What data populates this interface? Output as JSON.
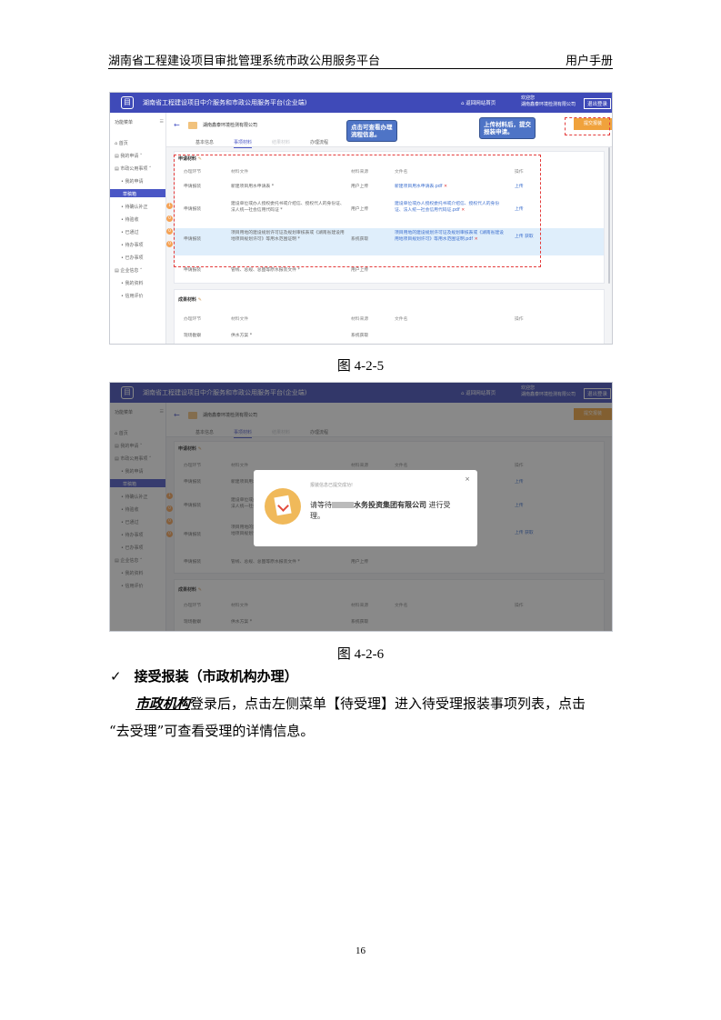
{
  "header": {
    "left": "湖南省工程建设项目审批管理系统市政公用服务平台",
    "right": "用户手册"
  },
  "app": {
    "title": "湖南省工程建设项目中介服务和市政公用服务平台(企业端)",
    "home_link": "⌂ 返回网站首页",
    "welcome_line1": "欢迎您",
    "welcome_line2": "湖南鑫泰环境检测有限公司",
    "logout": "退出登录",
    "company": "湖南鑫泰环境检测有限公司",
    "submit_button": "提交报装"
  },
  "sidebar": {
    "title": "功能菜单",
    "items": [
      "首页",
      "我的申请",
      "市政公用事项",
      "我的申请",
      "草稿箱",
      "待确认补正",
      "待验收",
      "已通过",
      "待办事项",
      "已办事项",
      "企业信息",
      "我的资料",
      "信用评价"
    ],
    "badges": [
      "1",
      "1",
      "0",
      "0",
      "0"
    ]
  },
  "tabs": [
    "基本信息",
    "事项材料",
    "结果材料",
    "办理流程"
  ],
  "apply_section": {
    "title": "申请材料",
    "headers": [
      "办理环节",
      "材料文件",
      "材料来源",
      "文件名",
      "操作"
    ],
    "rows": [
      {
        "stage": "申请报装",
        "material": "新建项目用水申请表 *",
        "source": "用户上传",
        "file": "新建项目用水申请表.pdf",
        "op": "上传"
      },
      {
        "stage": "申请报装",
        "material": "建设单位或办人授权委托书或介绍信、授权代人的身份证、法人统一社会信用代码证 *",
        "source": "用户上传",
        "file": "建设单位或办人授权委托书或介绍信、授权代人的身份证、法人统一社会信用代码证.pdf",
        "op": "上传"
      },
      {
        "stage": "申请报装",
        "material": "项目用地的建设规划许可证及规划审核表或《湖南省建设用地项目规划许可》等用水范围证明 *",
        "source": "系统获取",
        "file": "项目用地的建设规划许可证及规划审核表或《湖南省建设用地项目规划许可》等用水范围证明.pdf",
        "op": "上传 获取"
      },
      {
        "stage": "申请报装",
        "material": "管线、总规、总图等原水报装文件 *",
        "source": "用户上传",
        "file": "",
        "op": ""
      }
    ]
  },
  "result_section": {
    "title": "成果材料",
    "headers": [
      "办理环节",
      "材料文件",
      "材料来源",
      "文件名",
      "操作"
    ],
    "rows": [
      {
        "stage": "现场勘察",
        "material": "供水方案 *",
        "source": "系统获取"
      }
    ]
  },
  "callouts": {
    "flow": "点击可查看办理\n流程信息。",
    "upload": "上传材料后，提交\n报装申请。"
  },
  "modal": {
    "title": "报装信息已提交成功!",
    "msg_prefix": "请等待",
    "org": "水务投资集团有限公司",
    "msg_suffix": "进行受",
    "msg_line2": "理。"
  },
  "captions": {
    "fig1": "图 4-2-5",
    "fig2": "图 4-2-6"
  },
  "section_title": "接受报装（市政机构办理）",
  "section_tick": "✓",
  "para": {
    "lead": "市政机构",
    "line1_rest": "登录后，点击左侧菜单【待受理】进入待受理报装事项列表，点击",
    "line2": "“去受理”可查看受理的详情信息。"
  },
  "page_number": "16"
}
